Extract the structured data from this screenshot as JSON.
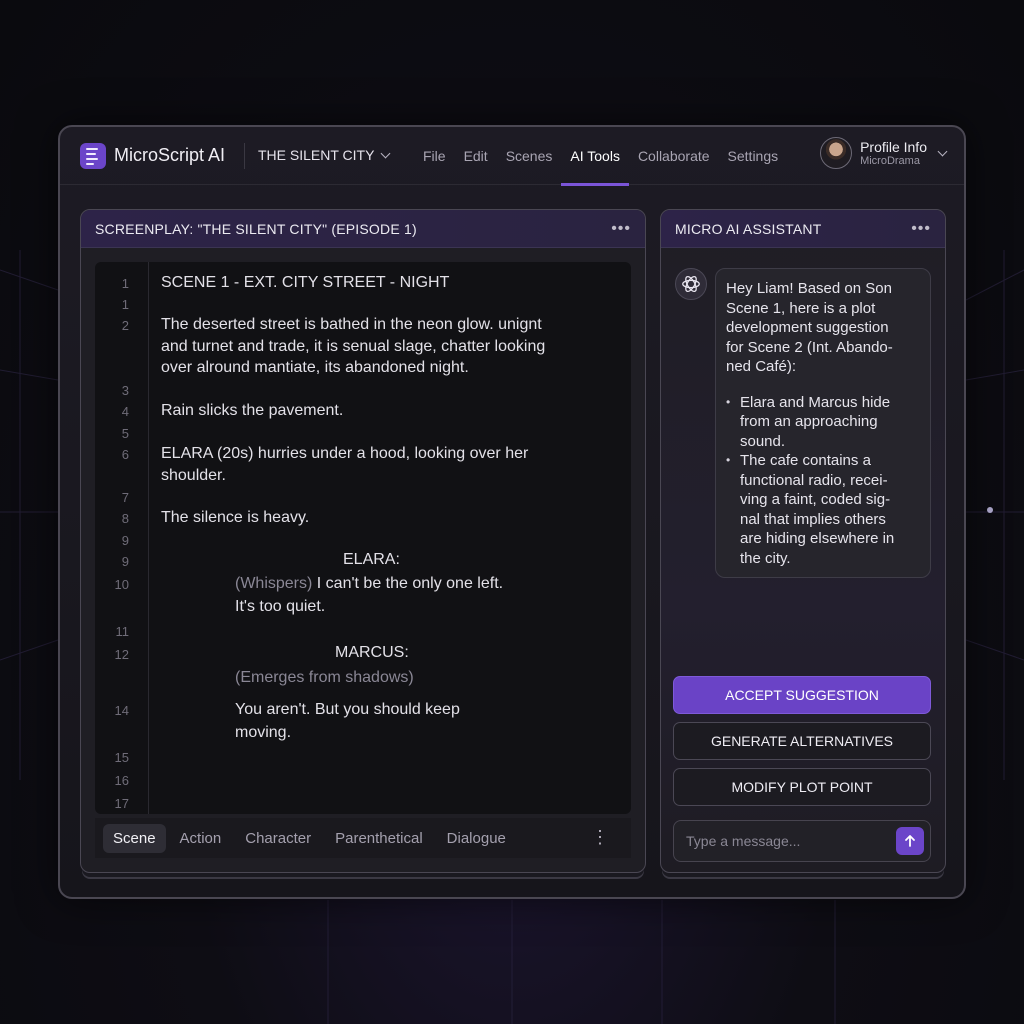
{
  "app": {
    "name": "MicroScript AI",
    "project": "THE SILENT CITY"
  },
  "nav": [
    "File",
    "Edit",
    "Scenes",
    "AI Tools",
    "Collaborate",
    "Settings"
  ],
  "nav_active": "AI Tools",
  "profile": {
    "name": "Profile Info",
    "subtitle": "MicroDrama"
  },
  "editor": {
    "title": "SCREENPLAY: \"THE SILENT CITY\" (EPISODE 1)",
    "line_numbers": [
      "1",
      "1",
      "2",
      "3",
      "4",
      "5",
      "6",
      "7",
      "8",
      "9",
      "9",
      "10",
      "11",
      "12",
      "14",
      "15",
      "16",
      "17"
    ],
    "lines": [
      "SCENE 1 - EXT. CITY STREET - NIGHT",
      "The deserted street is bathed in the neon glow. unignt",
      "and turnet and trade, it is senual slage, chatter looking",
      "over alround mantiate, its abandoned night.",
      "Rain slicks the pavement.",
      "ELARA (20s) hurries under a hood, looking over her",
      "shoulder.",
      "The silence is heavy.",
      "ELARA:",
      "(Whispers)",
      " I can't be the only one left.",
      "It's too quiet.",
      "MARCUS:",
      "(Emerges from shadows)",
      "You aren't. But you should keep",
      "moving."
    ],
    "element_types": [
      "Scene",
      "Action",
      "Character",
      "Parenthetical",
      "Dialogue"
    ],
    "active_element": "Scene"
  },
  "assistant": {
    "title": "MICRO AI ASSISTANT",
    "intro": "Hey Liam! Based on Son Scene 1, here is a plot development suggestion for Scene 2 (Int. Abandoned Café):",
    "intro_lines": [
      "Hey Liam! Based on Son",
      "Scene 1, here is a plot",
      "development suggestion",
      "for Scene 2 (Int. Abando-",
      "ned Café):"
    ],
    "bullets": [
      [
        "Elara and Marcus hide",
        "from an approaching",
        "sound."
      ],
      [
        "The cafe contains a",
        "functional radio, recei-",
        "ving a faint, coded sig-",
        "nal that implies others",
        "are hiding elsewhere in",
        "the city."
      ]
    ],
    "buttons": {
      "accept": "ACCEPT SUGGESTION",
      "generate": "GENERATE ALTERNATIVES",
      "modify": "MODIFY PLOT POINT"
    },
    "message_placeholder": "Type a message..."
  },
  "colors": {
    "accent": "#6b45c9",
    "panel_header": "#2d2348",
    "background": "#0e0d14"
  },
  "icons": {
    "logo": "script-document-icon",
    "ai": "openai-knot-icon",
    "send": "arrow-up-icon"
  }
}
